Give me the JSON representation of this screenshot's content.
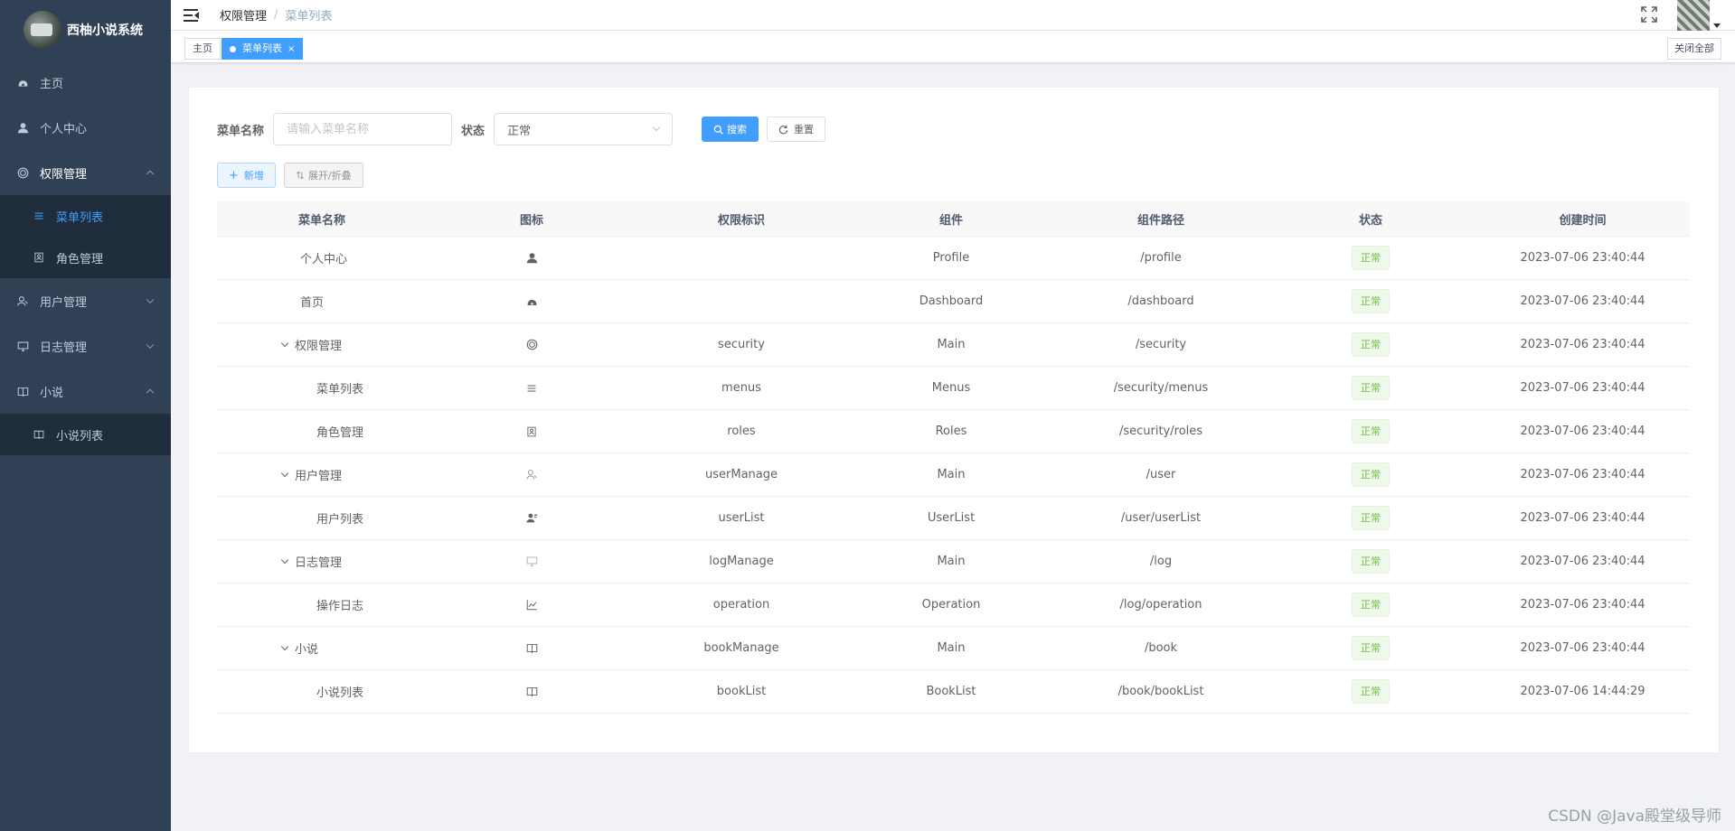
{
  "app": {
    "title": "西柚小说系统"
  },
  "sidebar": {
    "items": [
      {
        "label": "主页",
        "icon": "dashboard-icon"
      },
      {
        "label": "个人中心",
        "icon": "user-icon"
      },
      {
        "label": "权限管理",
        "icon": "security-icon",
        "expanded": true
      },
      {
        "label": "用户管理",
        "icon": "peoples-icon"
      },
      {
        "label": "日志管理",
        "icon": "monitor-icon"
      },
      {
        "label": "小说",
        "icon": "book-icon",
        "expanded": true
      }
    ],
    "security_sub": [
      {
        "label": "菜单列表",
        "icon": "list-icon",
        "active": true
      },
      {
        "label": "角色管理",
        "icon": "role-icon"
      }
    ],
    "book_sub": [
      {
        "label": "小说列表",
        "icon": "book-icon"
      }
    ]
  },
  "navbar": {
    "breadcrumb": [
      "权限管理",
      "菜单列表"
    ],
    "separator": "/"
  },
  "tags": {
    "home": "主页",
    "current": "菜单列表",
    "close_symbol": "×",
    "close_all": "关闭全部"
  },
  "search": {
    "name_label": "菜单名称",
    "name_placeholder": "请输入菜单名称",
    "status_label": "状态",
    "status_value": "正常",
    "search_button": "搜索",
    "reset_button": "重置"
  },
  "actions": {
    "add_button": "新增",
    "expand_button": "展开/折叠"
  },
  "table": {
    "columns": [
      "菜单名称",
      "图标",
      "权限标识",
      "组件",
      "组件路径",
      "状态",
      "创建时间"
    ],
    "rows": [
      {
        "name": "个人中心",
        "icon": "user-icon",
        "perm": "",
        "component": "Profile",
        "path": "/profile",
        "status": "正常",
        "created": "2023-07-06 23:40:44",
        "level": 0,
        "arrow": false
      },
      {
        "name": "首页",
        "icon": "dashboard-icon",
        "perm": "",
        "component": "Dashboard",
        "path": "/dashboard",
        "status": "正常",
        "created": "2023-07-06 23:40:44",
        "level": 0,
        "arrow": false
      },
      {
        "name": "权限管理",
        "icon": "security-icon",
        "perm": "security",
        "component": "Main",
        "path": "/security",
        "status": "正常",
        "created": "2023-07-06 23:40:44",
        "level": 0,
        "arrow": true
      },
      {
        "name": "菜单列表",
        "icon": "list-icon",
        "perm": "menus",
        "component": "Menus",
        "path": "/security/menus",
        "status": "正常",
        "created": "2023-07-06 23:40:44",
        "level": 1,
        "arrow": false
      },
      {
        "name": "角色管理",
        "icon": "role-icon",
        "perm": "roles",
        "component": "Roles",
        "path": "/security/roles",
        "status": "正常",
        "created": "2023-07-06 23:40:44",
        "level": 1,
        "arrow": false
      },
      {
        "name": "用户管理",
        "icon": "peoples-icon",
        "perm": "userManage",
        "component": "Main",
        "path": "/user",
        "status": "正常",
        "created": "2023-07-06 23:40:44",
        "level": 0,
        "arrow": true
      },
      {
        "name": "用户列表",
        "icon": "user-list-icon",
        "perm": "userList",
        "component": "UserList",
        "path": "/user/userList",
        "status": "正常",
        "created": "2023-07-06 23:40:44",
        "level": 1,
        "arrow": false
      },
      {
        "name": "日志管理",
        "icon": "monitor-icon",
        "perm": "logManage",
        "component": "Main",
        "path": "/log",
        "status": "正常",
        "created": "2023-07-06 23:40:44",
        "level": 0,
        "arrow": true
      },
      {
        "name": "操作日志",
        "icon": "chart-icon",
        "perm": "operation",
        "component": "Operation",
        "path": "/log/operation",
        "status": "正常",
        "created": "2023-07-06 23:40:44",
        "level": 1,
        "arrow": false
      },
      {
        "name": "小说",
        "icon": "book-icon",
        "perm": "bookManage",
        "component": "Main",
        "path": "/book",
        "status": "正常",
        "created": "2023-07-06 23:40:44",
        "level": 0,
        "arrow": true
      },
      {
        "name": "小说列表",
        "icon": "book-icon",
        "perm": "bookList",
        "component": "BookList",
        "path": "/book/bookList",
        "status": "正常",
        "created": "2023-07-06 14:44:29",
        "level": 1,
        "arrow": false
      }
    ]
  },
  "watermark": "CSDN @Java殿堂级导师",
  "colors": {
    "sidebar_bg": "#304156",
    "submenu_bg": "#1f2d3d",
    "accent": "#409eff",
    "success": "#67c23a"
  }
}
